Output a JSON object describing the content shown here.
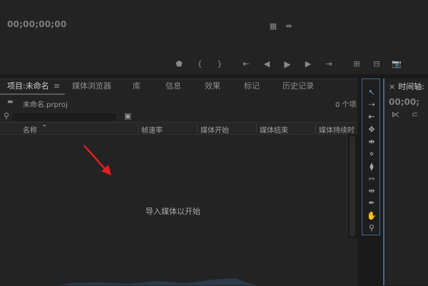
{
  "program_monitor": {
    "timecode": "00;00;00;00",
    "icons": {
      "marker": "marker-icon",
      "in_point": "mark-in-icon",
      "out_point": "mark-out-icon",
      "go_to_in": "go-to-in-icon",
      "step_back": "step-back-icon",
      "play": "play-icon",
      "step_forward": "step-forward-icon",
      "go_to_out": "go-to-out-icon",
      "lift": "lift-icon",
      "extract": "extract-icon",
      "export_frame": "camera-icon"
    },
    "glyphs": {
      "marker": "⬟",
      "in_point": "{",
      "out_point": "}",
      "go_to_in": "⇤",
      "step_back": "◀",
      "play": "▶",
      "step_forward": "▶",
      "go_to_out": "⇥",
      "lift": "⊞",
      "extract": "⊟",
      "export_frame": "📷",
      "film": "▦",
      "settings": "⇹"
    }
  },
  "project_panel": {
    "tabs": [
      {
        "label": "项目:未命名",
        "active": true
      },
      {
        "label": "媒体浏览器"
      },
      {
        "label": "库"
      },
      {
        "label": "信息"
      },
      {
        "label": "效果"
      },
      {
        "label": "标记"
      },
      {
        "label": "历史记录"
      }
    ],
    "tab_menu_glyph": "≡",
    "project_file": "未命名.prproj",
    "item_count": "0 个项",
    "folder_glyph": "▬",
    "bin_glyph": "▣",
    "search_glyph": "⚲",
    "columns": [
      "名称",
      "帧速率",
      "媒体开始",
      "媒体结束",
      "媒体持续时"
    ],
    "sort_glyph": "⌃",
    "empty_message": "导入媒体以开始"
  },
  "tools": [
    {
      "name": "selection-tool-icon",
      "glyph": "↖"
    },
    {
      "name": "track-select-tool-icon",
      "glyph": "⇢"
    },
    {
      "name": "ripple-edit-tool-icon",
      "glyph": "⇤"
    },
    {
      "name": "rolling-edit-tool-icon",
      "glyph": "✥"
    },
    {
      "name": "rate-stretch-tool-icon",
      "glyph": "⇼"
    },
    {
      "name": "razor-tool-icon",
      "glyph": "⋄"
    },
    {
      "name": "slip-tool-icon",
      "glyph": "⧫"
    },
    {
      "name": "slide-tool-icon",
      "glyph": "⇿"
    },
    {
      "name": "pen-tool-icon",
      "glyph": "⇹"
    },
    {
      "name": "hand-tool-icon",
      "glyph": "✒"
    },
    {
      "name": "zoom-tool-icon",
      "glyph": "✋"
    },
    {
      "name": "magnify-tool-icon",
      "glyph": "⚲"
    }
  ],
  "timeline_panel": {
    "close_glyph": "×",
    "tab_label": "时间轴:",
    "timecode": "00;00;",
    "snap_glyph": "⋉",
    "link_glyph": "⊂"
  },
  "annotation": {
    "arrow_color": "#e02020"
  },
  "colors": {
    "accent_blue": "#3c6b92",
    "panel_bg": "#232323"
  }
}
